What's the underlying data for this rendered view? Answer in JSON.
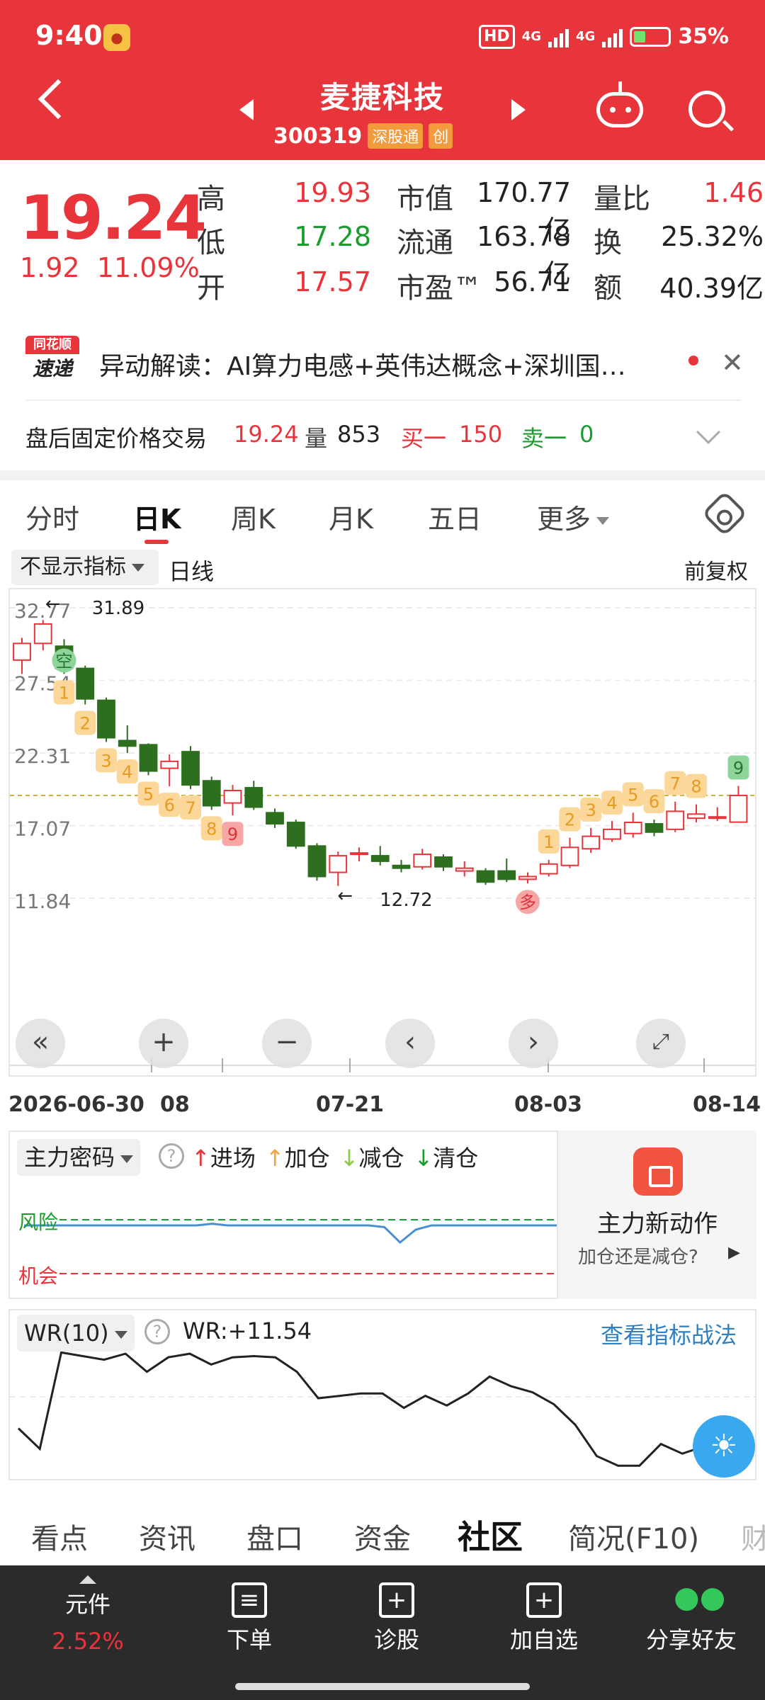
{
  "status_bar": {
    "time": "9:40",
    "hd": "HD",
    "net1": "4G",
    "net2": "4G",
    "battery": "35%"
  },
  "header": {
    "title": "麦捷科技",
    "code": "300319",
    "tag1": "深股通",
    "tag2": "创"
  },
  "quote": {
    "price": "19.24",
    "change": "1.92",
    "change_pct": "11.09%",
    "labels": [
      "高",
      "低",
      "开",
      "市值",
      "流通",
      "市盈™",
      "量比",
      "换",
      "额"
    ],
    "values": [
      "19.93",
      "17.28",
      "17.57",
      "170.77亿",
      "163.78亿",
      "56.71",
      "1.46",
      "25.32%",
      "40.39亿"
    ]
  },
  "alert": {
    "logo_top": "同花顺",
    "logo_bottom": "速递",
    "text": "异动解读：AI算力电感+英伟达概念+深圳国…"
  },
  "after_hours": {
    "label": "盘后固定价格交易",
    "price": "19.24",
    "vol_label": "量",
    "vol": "853",
    "buy_label": "买一",
    "buy": "150",
    "sell_label": "卖一",
    "sell": "0"
  },
  "chart_tabs": [
    "分时",
    "日K",
    "周K",
    "月K",
    "五日",
    "更多"
  ],
  "indicator_bar": {
    "select": "不显示指标",
    "line": "日线",
    "adjust": "前复权"
  },
  "chart_data": {
    "type": "candlestick",
    "y_ticks": [
      "32.77",
      "27.54",
      "22.31",
      "17.07",
      "11.84"
    ],
    "ylim": [
      11.84,
      32.77
    ],
    "x_labels": [
      "2026-06-30",
      "08",
      "07-21",
      "08-03",
      "08-14"
    ],
    "high_mark": "31.89",
    "low_mark": "12.72",
    "current_line": 19.24,
    "candles": [
      {
        "o": 29.0,
        "c": 30.2,
        "h": 30.6,
        "l": 28.0
      },
      {
        "o": 30.2,
        "c": 31.6,
        "h": 31.89,
        "l": 29.7
      },
      {
        "o": 30.0,
        "c": 28.4,
        "h": 30.5,
        "l": 28.0
      },
      {
        "o": 28.4,
        "c": 26.2,
        "h": 28.6,
        "l": 25.8
      },
      {
        "o": 26.1,
        "c": 23.4,
        "h": 26.3,
        "l": 23.1
      },
      {
        "o": 23.2,
        "c": 22.8,
        "h": 24.3,
        "l": 22.3
      },
      {
        "o": 22.9,
        "c": 21.0,
        "h": 23.0,
        "l": 20.7
      },
      {
        "o": 21.2,
        "c": 21.7,
        "h": 22.2,
        "l": 19.9
      },
      {
        "o": 22.4,
        "c": 20.0,
        "h": 22.8,
        "l": 19.7
      },
      {
        "o": 20.3,
        "c": 18.5,
        "h": 20.6,
        "l": 18.2
      },
      {
        "o": 18.7,
        "c": 19.6,
        "h": 20.0,
        "l": 17.8
      },
      {
        "o": 19.8,
        "c": 18.4,
        "h": 20.3,
        "l": 18.2
      },
      {
        "o": 18.0,
        "c": 17.2,
        "h": 18.3,
        "l": 16.9
      },
      {
        "o": 17.3,
        "c": 15.6,
        "h": 17.5,
        "l": 15.4
      },
      {
        "o": 15.6,
        "c": 13.4,
        "h": 15.8,
        "l": 13.1
      },
      {
        "o": 13.7,
        "c": 14.9,
        "h": 15.2,
        "l": 12.72
      },
      {
        "o": 15.0,
        "c": 15.1,
        "h": 15.5,
        "l": 14.5
      },
      {
        "o": 14.9,
        "c": 14.5,
        "h": 15.6,
        "l": 14.2
      },
      {
        "o": 14.2,
        "c": 14.0,
        "h": 14.6,
        "l": 13.7
      },
      {
        "o": 14.1,
        "c": 15.0,
        "h": 15.4,
        "l": 13.9
      },
      {
        "o": 14.8,
        "c": 14.1,
        "h": 15.0,
        "l": 13.8
      },
      {
        "o": 13.8,
        "c": 14.0,
        "h": 14.5,
        "l": 13.4
      },
      {
        "o": 13.8,
        "c": 13.0,
        "h": 14.0,
        "l": 12.8
      },
      {
        "o": 13.8,
        "c": 13.2,
        "h": 14.7,
        "l": 13.0
      },
      {
        "o": 13.2,
        "c": 13.4,
        "h": 13.7,
        "l": 12.9
      },
      {
        "o": 13.6,
        "c": 14.3,
        "h": 14.6,
        "l": 13.4
      },
      {
        "o": 14.2,
        "c": 15.5,
        "h": 16.2,
        "l": 14.0
      },
      {
        "o": 15.4,
        "c": 16.3,
        "h": 16.9,
        "l": 15.1
      },
      {
        "o": 16.1,
        "c": 16.8,
        "h": 17.4,
        "l": 15.9
      },
      {
        "o": 16.5,
        "c": 17.3,
        "h": 18.0,
        "l": 16.2
      },
      {
        "o": 17.2,
        "c": 16.6,
        "h": 17.5,
        "l": 16.3
      },
      {
        "o": 16.8,
        "c": 18.1,
        "h": 18.8,
        "l": 16.6
      },
      {
        "o": 17.6,
        "c": 17.9,
        "h": 18.6,
        "l": 17.3
      },
      {
        "o": 17.6,
        "c": 17.7,
        "h": 18.4,
        "l": 17.4
      },
      {
        "o": 17.32,
        "c": 19.24,
        "h": 19.93,
        "l": 17.28
      }
    ],
    "markers": [
      {
        "i": 2,
        "t": "空",
        "k": "green-circle"
      },
      {
        "i": 2,
        "t": "1",
        "k": "orange"
      },
      {
        "i": 3,
        "t": "2",
        "k": "orange"
      },
      {
        "i": 4,
        "t": "3",
        "k": "orange"
      },
      {
        "i": 5,
        "t": "4",
        "k": "orange"
      },
      {
        "i": 6,
        "t": "5",
        "k": "orange"
      },
      {
        "i": 7,
        "t": "6",
        "k": "orange"
      },
      {
        "i": 8,
        "t": "7",
        "k": "orange"
      },
      {
        "i": 9,
        "t": "8",
        "k": "orange"
      },
      {
        "i": 10,
        "t": "9",
        "k": "red"
      },
      {
        "i": 24,
        "t": "多",
        "k": "red-circle"
      },
      {
        "i": 25,
        "t": "1",
        "k": "orange"
      },
      {
        "i": 26,
        "t": "2",
        "k": "orange"
      },
      {
        "i": 27,
        "t": "3",
        "k": "orange"
      },
      {
        "i": 28,
        "t": "4",
        "k": "orange"
      },
      {
        "i": 29,
        "t": "5",
        "k": "orange"
      },
      {
        "i": 30,
        "t": "6",
        "k": "orange"
      },
      {
        "i": 31,
        "t": "7",
        "k": "orange"
      },
      {
        "i": 32,
        "t": "8",
        "k": "orange"
      },
      {
        "i": 34,
        "t": "9",
        "k": "green"
      }
    ],
    "risk_line": [
      40,
      40,
      40,
      40,
      40,
      40,
      40,
      40,
      40,
      40,
      40,
      40,
      42,
      40,
      40,
      40,
      40,
      40,
      40,
      40,
      40,
      40,
      40,
      38,
      20,
      35,
      40,
      40,
      40,
      40,
      40,
      40,
      40,
      40,
      40
    ],
    "wr_value": "WR:+11.54",
    "wr_line": [
      65,
      82,
      2,
      5,
      8,
      3,
      18,
      6,
      3,
      12,
      6,
      5,
      6,
      18,
      40,
      38,
      36,
      36,
      48,
      38,
      46,
      36,
      22,
      30,
      35,
      45,
      62,
      88,
      96,
      96,
      78,
      86,
      80,
      72,
      84
    ]
  },
  "zhuli": {
    "select": "主力密码",
    "legend": [
      "进场",
      "加仓",
      "减仓",
      "清仓"
    ],
    "risk": "风险",
    "chance": "机会",
    "card_title": "主力新动作",
    "card_sub": "加仓还是减仓?"
  },
  "wr": {
    "select": "WR(10)",
    "value": "WR:+11.54",
    "link": "查看指标战法"
  },
  "bottom_tabs": [
    "看点",
    "资讯",
    "盘口",
    "资金",
    "社区",
    "简况(F10)",
    "财"
  ],
  "bottom_bar": {
    "item0_label": "元件",
    "item0_pct": "2.52%",
    "items": [
      "下单",
      "诊股",
      "加自选",
      "分享好友"
    ]
  }
}
